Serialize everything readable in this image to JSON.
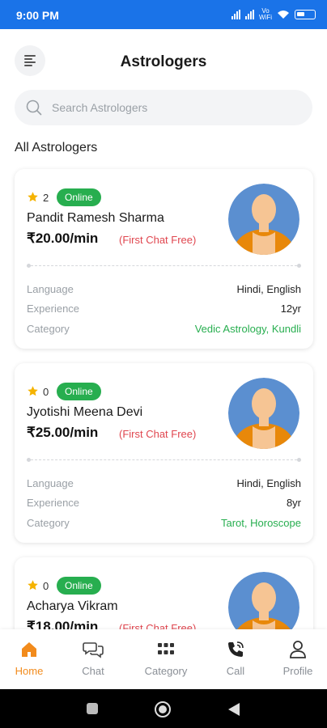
{
  "status_bar": {
    "time": "9:00 PM",
    "network_label": "Vo WiFi"
  },
  "header": {
    "title": "Astrologers"
  },
  "search": {
    "placeholder": "Search Astrologers"
  },
  "section": {
    "title": "All Astrologers"
  },
  "colors": {
    "status_bar": "#1a73e8",
    "online_green": "#27ae4f",
    "offer_red": "#e0464f",
    "accent_orange": "#f28b1c",
    "star": "#f5b301",
    "avatar_bg": "#5b8fd0",
    "robe": "#e8880a",
    "skin": "#f6c594"
  },
  "astrologers": [
    {
      "rating": "2",
      "status": "Online",
      "name": "Pandit Ramesh Sharma",
      "price": "₹20.00/min",
      "offer": "(First Chat Free)",
      "details": [
        {
          "label": "Language",
          "value": "Hindi, English"
        },
        {
          "label": "Experience",
          "value": "12yr"
        },
        {
          "label": "Category",
          "value": "Vedic Astrology, Kundli"
        }
      ]
    },
    {
      "rating": "0",
      "status": "Online",
      "name": "Jyotishi Meena Devi",
      "price": "₹25.00/min",
      "offer": "(First Chat Free)",
      "details": [
        {
          "label": "Language",
          "value": "Hindi, English"
        },
        {
          "label": "Experience",
          "value": "8yr"
        },
        {
          "label": "Category",
          "value": "Tarot, Horoscope"
        }
      ]
    },
    {
      "rating": "0",
      "status": "Online",
      "name": "Acharya Vikram",
      "price": "₹18.00/min",
      "offer": "(First Chat Free)"
    }
  ],
  "bottom_nav": [
    {
      "label": "Home",
      "icon": "home-icon",
      "active": true
    },
    {
      "label": "Chat",
      "icon": "chat-icon",
      "active": false
    },
    {
      "label": "Category",
      "icon": "grid-icon",
      "active": false
    },
    {
      "label": "Call",
      "icon": "phone-icon",
      "active": false
    },
    {
      "label": "Profile",
      "icon": "user-icon",
      "active": false
    }
  ]
}
